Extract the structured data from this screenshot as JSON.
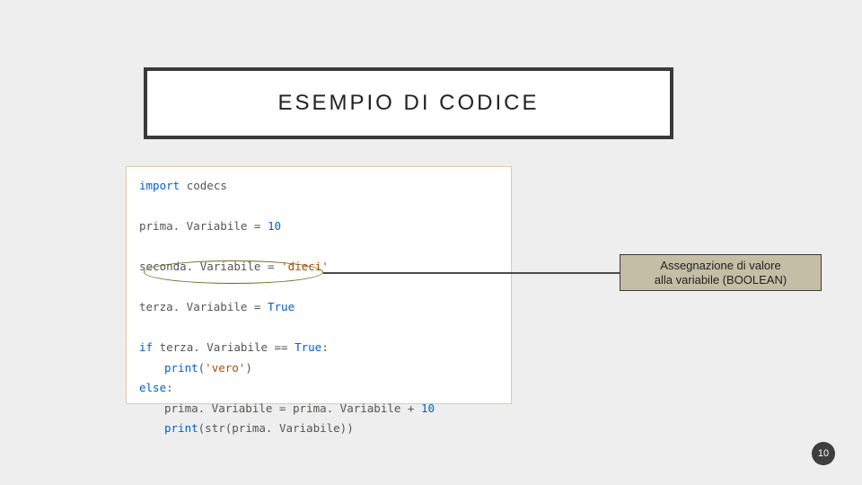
{
  "slide_title": "ESEMPIO DI CODICE",
  "code": {
    "import_kw": "import",
    "import_mod": "codecs",
    "line2_a": "prima. Variabile = ",
    "line2_b": "10",
    "line3_a": "seconda. Variabile = ",
    "line3_b": "'dieci'",
    "line4_a": "terza. Variabile = ",
    "line4_b": "True",
    "line5_if": "if",
    "line5_a": " terza. Variabile == ",
    "line5_b": "True",
    "line5_c": ":",
    "line6_print": "print",
    "line6_a": "(",
    "line6_b": "'vero'",
    "line6_c": ")",
    "line7_else": "else",
    "line7_c": ":",
    "line8_a": "prima. Variabile = prima. Variabile + ",
    "line8_b": "10",
    "line9_print": "print",
    "line9_a": "(str(prima. Variabile))"
  },
  "annotation": {
    "line1": "Assegnazione di valore",
    "line2": "alla variabile (BOOLEAN)"
  },
  "page_number": "10"
}
